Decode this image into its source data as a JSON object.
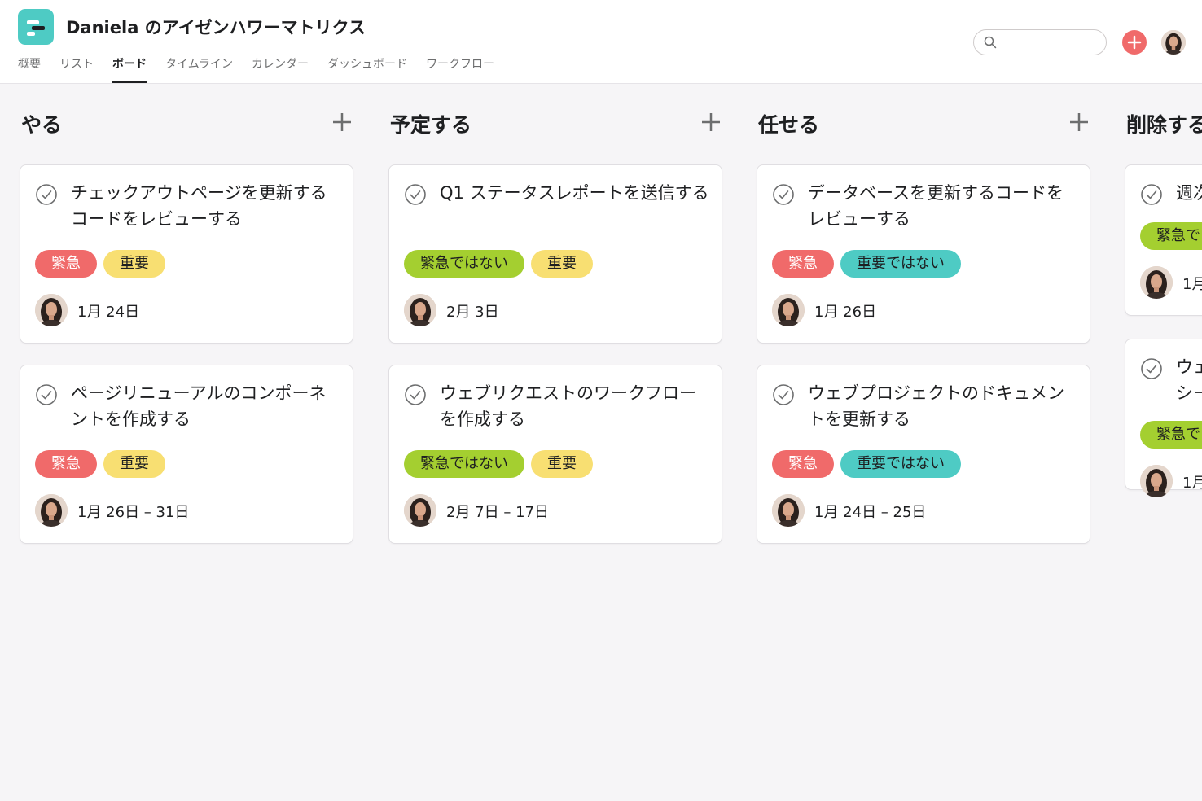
{
  "project": {
    "title": "Daniela のアイゼンハワーマトリクス"
  },
  "tabs": [
    {
      "label": "概要"
    },
    {
      "label": "リスト"
    },
    {
      "label": "ボード"
    },
    {
      "label": "タイムライン"
    },
    {
      "label": "カレンダー"
    },
    {
      "label": "ダッシュボード"
    },
    {
      "label": "ワークフロー"
    }
  ],
  "active_tab": "ボード",
  "search": {
    "placeholder": ""
  },
  "colors": {
    "accent": "#f06a6a",
    "urgent": "#f06a6a",
    "important": "#f8df72",
    "not_urgent": "#a4cf30",
    "not_important": "#4ecbc4"
  },
  "columns": [
    {
      "title": "やる",
      "cards": [
        {
          "title": "チェックアウトページを更新するコードをレビューする",
          "tags": [
            {
              "label": "緊急",
              "color": "red"
            },
            {
              "label": "重要",
              "color": "yellow"
            }
          ],
          "date": "1月 24日"
        },
        {
          "title": "ページリニューアルのコンポーネントを作成する",
          "tags": [
            {
              "label": "緊急",
              "color": "red"
            },
            {
              "label": "重要",
              "color": "yellow"
            }
          ],
          "date": "1月 26日 – 31日"
        }
      ]
    },
    {
      "title": "予定する",
      "cards": [
        {
          "title": "Q1 ステータスレポートを送信する",
          "tags": [
            {
              "label": "緊急ではない",
              "color": "green"
            },
            {
              "label": "重要",
              "color": "yellow"
            }
          ],
          "date": "2月 3日"
        },
        {
          "title": "ウェブリクエストのワークフローを作成する",
          "tags": [
            {
              "label": "緊急ではない",
              "color": "green"
            },
            {
              "label": "重要",
              "color": "yellow"
            }
          ],
          "date": "2月 7日 – 17日"
        }
      ]
    },
    {
      "title": "任せる",
      "cards": [
        {
          "title": "データベースを更新するコードをレビューする",
          "tags": [
            {
              "label": "緊急",
              "color": "red"
            },
            {
              "label": "重要ではない",
              "color": "teal"
            }
          ],
          "date": "1月 26日"
        },
        {
          "title": "ウェブプロジェクトのドキュメントを更新する",
          "tags": [
            {
              "label": "緊急",
              "color": "red"
            },
            {
              "label": "重要ではない",
              "color": "teal"
            }
          ],
          "date": "1月 24日 – 25日"
        }
      ]
    },
    {
      "title": "削除する",
      "cards": [
        {
          "title": "週次",
          "tags": [
            {
              "label": "緊急で",
              "color": "green"
            }
          ],
          "date": "1月"
        },
        {
          "title": "ウェ シー",
          "tags": [
            {
              "label": "緊急で",
              "color": "green"
            }
          ],
          "date": "1月"
        }
      ]
    }
  ]
}
